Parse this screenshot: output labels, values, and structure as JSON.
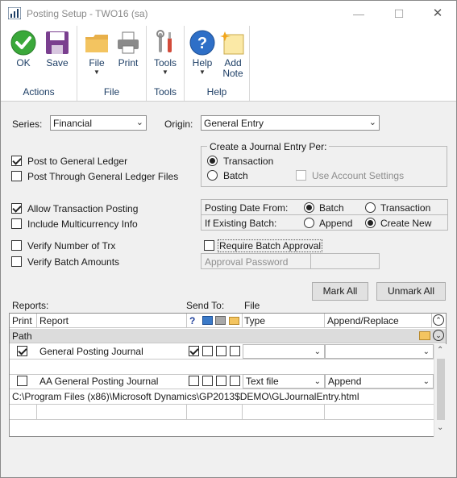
{
  "window": {
    "title": "Posting Setup  -  TWO16 (sa)"
  },
  "ribbon": {
    "groups": [
      {
        "label": "Actions",
        "buttons": [
          {
            "label": "OK",
            "icon": "ok-check-icon"
          },
          {
            "label": "Save",
            "icon": "save-disk-icon"
          }
        ]
      },
      {
        "label": "File",
        "buttons": [
          {
            "label": "File",
            "icon": "folder-icon"
          },
          {
            "label": "Print",
            "icon": "printer-icon"
          }
        ]
      },
      {
        "label": "Tools",
        "buttons": [
          {
            "label": "Tools",
            "icon": "tools-icon"
          }
        ]
      },
      {
        "label": "Help",
        "buttons": [
          {
            "label": "Help",
            "icon": "help-icon"
          },
          {
            "label": "Add",
            "label2": "Note",
            "icon": "add-note-icon"
          }
        ]
      }
    ]
  },
  "form": {
    "series_label": "Series:",
    "series_value": "Financial",
    "origin_label": "Origin:",
    "origin_value": "General Entry",
    "post_to_gl": "Post to General Ledger",
    "post_through_gl": "Post Through General Ledger Files",
    "journal_group_title": "Create a Journal Entry Per:",
    "journal_transaction": "Transaction",
    "journal_batch": "Batch",
    "use_account_settings": "Use Account Settings",
    "allow_transaction_posting": "Allow Transaction Posting",
    "include_multicurrency": "Include Multicurrency Info",
    "posting_date_from_label": "Posting Date From:",
    "posting_date_batch": "Batch",
    "posting_date_transaction": "Transaction",
    "if_existing_batch_label": "If Existing Batch:",
    "existing_append": "Append",
    "existing_create_new": "Create New",
    "verify_number_of_trx": "Verify Number of Trx",
    "verify_batch_amounts": "Verify Batch Amounts",
    "require_batch_approval": "Require Batch Approval",
    "approval_password_label": "Approval Password",
    "approval_password_value": ""
  },
  "buttons": {
    "mark_all": "Mark All",
    "unmark_all": "Unmark All"
  },
  "reports": {
    "reports_label": "Reports:",
    "send_to_label": "Send To:",
    "file_label": "File",
    "columns": {
      "print": "Print",
      "report": "Report",
      "help": "?",
      "type": "Type",
      "append_replace": "Append/Replace",
      "path": "Path"
    },
    "rows": [
      {
        "print": true,
        "report": "General Posting Journal",
        "send_help": true,
        "type": "",
        "append_replace": "",
        "path": ""
      },
      {
        "print": false,
        "report": "AA General Posting Journal",
        "send_help": false,
        "type": "Text file",
        "append_replace": "Append",
        "path": "C:\\Program Files (x86)\\Microsoft Dynamics\\GP2013$DEMO\\GLJournalEntry.html"
      }
    ]
  }
}
